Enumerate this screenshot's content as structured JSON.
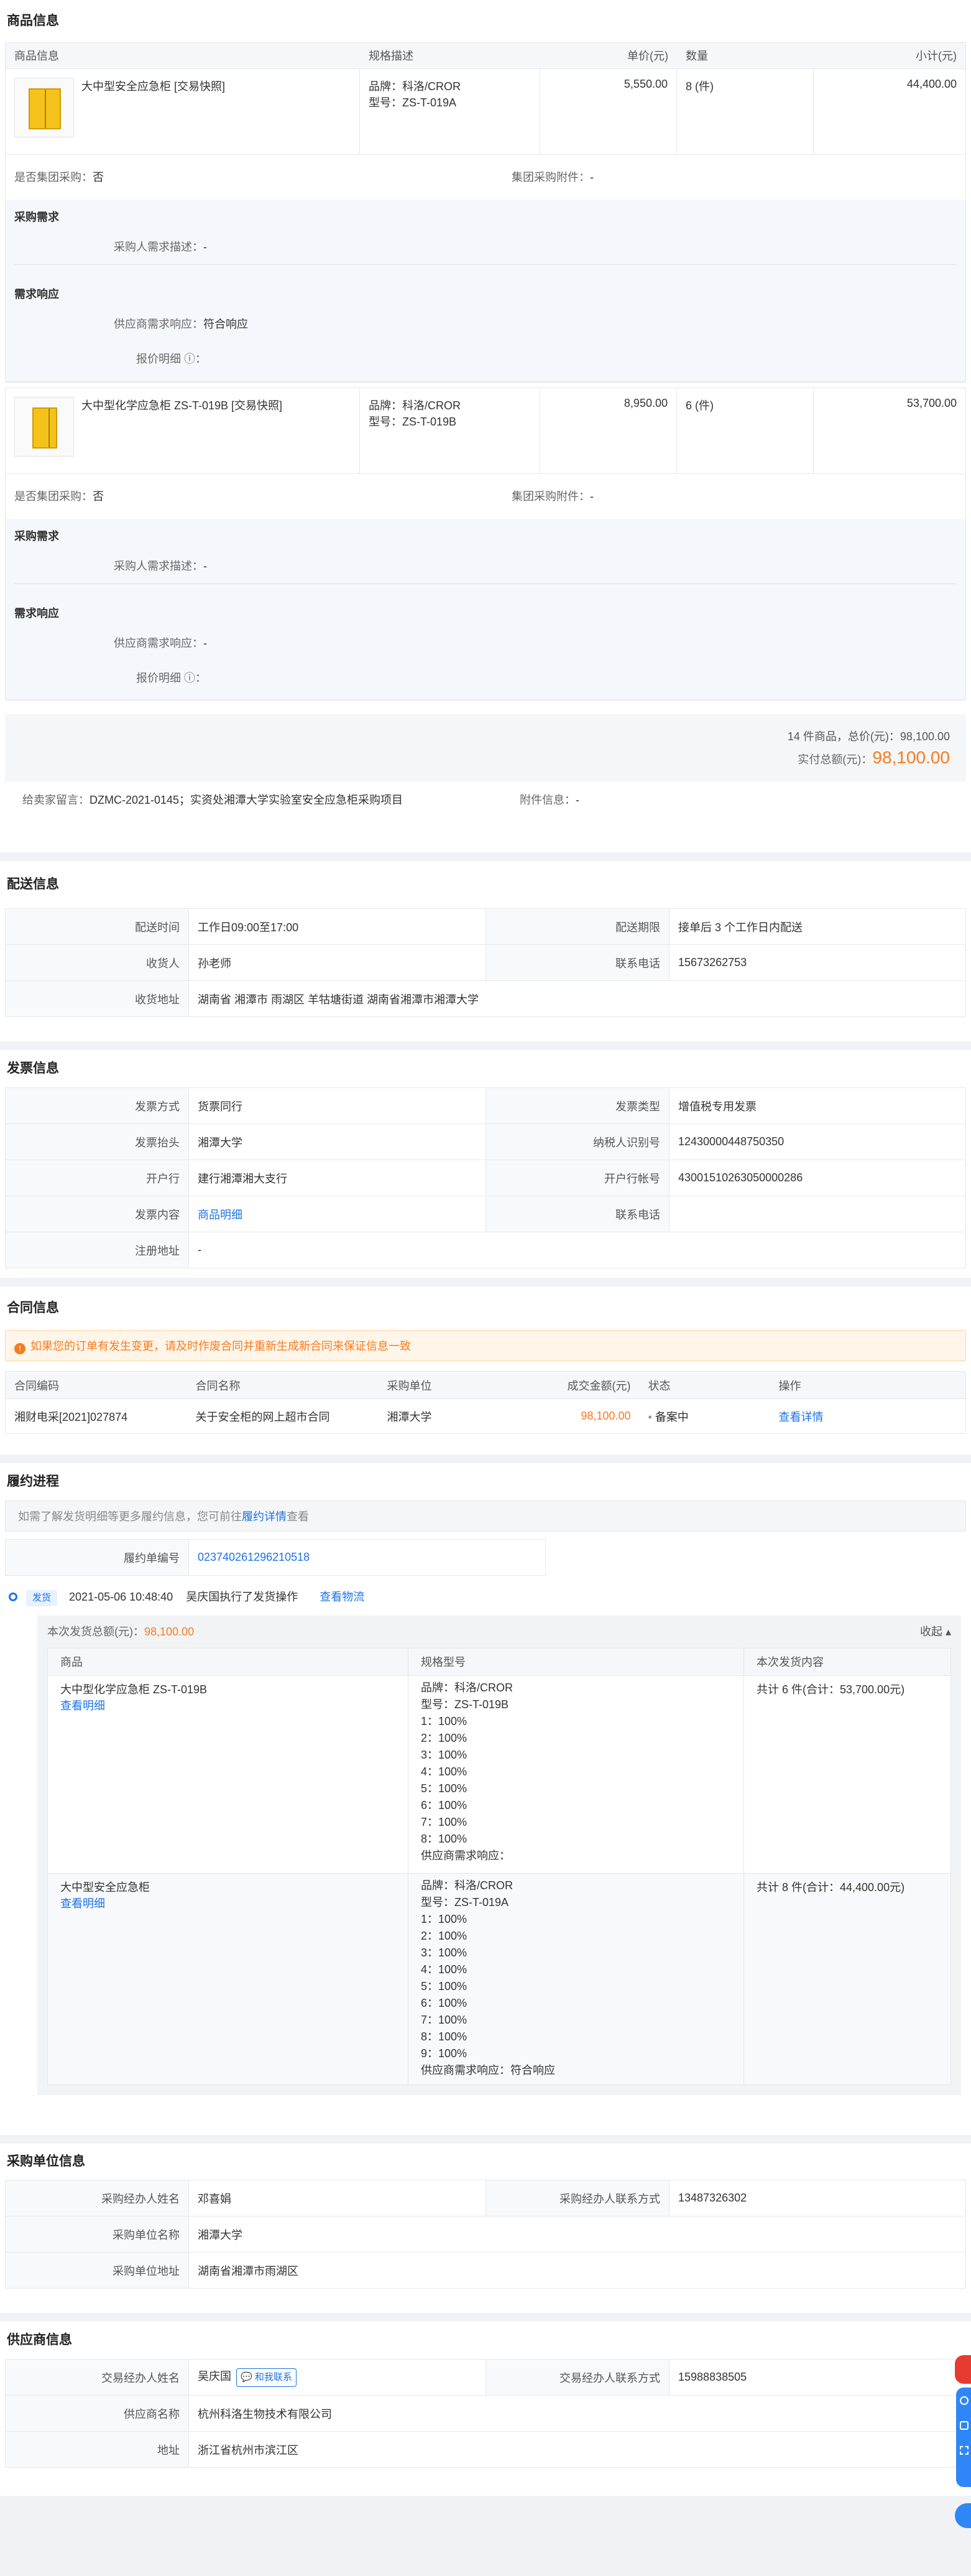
{
  "goods": {
    "title": "商品信息",
    "headers": [
      "商品信息",
      "规格描述",
      "单价(元)",
      "数量",
      "小计(元)"
    ],
    "items": [
      {
        "name": "大中型安全应急柜 [交易快照]",
        "brand": "品牌：科洛/CROR",
        "model": "型号：ZS-T-019A",
        "price": "5,550.00",
        "qty": "8 (件)",
        "subtotal": "44,400.00",
        "group_label": "是否集团采购：",
        "group_value": "否",
        "attach_label": "集团采购附件：",
        "attach_value": "-",
        "purchase_title": "采购需求",
        "purchase_desc_label": "采购人需求描述：",
        "purchase_desc_value": "-",
        "response_title": "需求响应",
        "response_label": "供应商需求响应：",
        "response_value": "符合响应",
        "quote_label": "报价明细 ⓘ："
      },
      {
        "name": "大中型化学应急柜 ZS-T-019B [交易快照]",
        "brand": "品牌：科洛/CROR",
        "model": "型号：ZS-T-019B",
        "price": "8,950.00",
        "qty": "6 (件)",
        "subtotal": "53,700.00",
        "group_label": "是否集团采购：",
        "group_value": "否",
        "attach_label": "集团采购附件：",
        "attach_value": "-",
        "purchase_title": "采购需求",
        "purchase_desc_label": "采购人需求描述：",
        "purchase_desc_value": "-",
        "response_title": "需求响应",
        "response_label": "供应商需求响应：",
        "response_value": "-",
        "quote_label": "报价明细 ⓘ："
      }
    ],
    "summary_line": "14 件商品，总价(元)：98,100.00",
    "paid_label": "实付总额(元)：",
    "paid_value": "98,100.00",
    "note_label": "给卖家留言：",
    "note_value": "DZMC-2021-0145；实资处湘潭大学实验室安全应急柜采购项目",
    "note_attach_label": "附件信息：",
    "note_attach_value": "-"
  },
  "delivery": {
    "title": "配送信息",
    "rows": [
      [
        "配送时间",
        "工作日09:00至17:00",
        "配送期限",
        "接单后 3 个工作日内配送"
      ],
      [
        "收货人",
        "孙老师",
        "联系电话",
        "15673262753"
      ],
      [
        "收货地址",
        "湖南省 湘潭市 雨湖区 羊牯塘街道 湖南省湘潭市湘潭大学",
        "",
        ""
      ]
    ]
  },
  "invoice": {
    "title": "发票信息",
    "rows": [
      [
        "发票方式",
        "货票同行",
        "发票类型",
        "增值税专用发票"
      ],
      [
        "发票抬头",
        "湘潭大学",
        "纳税人识别号",
        "12430000448750350"
      ],
      [
        "开户行",
        "建行湘潭湘大支行",
        "开户行帐号",
        "43001510263050000286"
      ],
      [
        "发票内容",
        "商品明细",
        "联系电话",
        ""
      ],
      [
        "注册地址",
        "-",
        "",
        ""
      ]
    ]
  },
  "contract": {
    "title": "合同信息",
    "alert": "如果您的订单有发生变更，请及时作废合同并重新生成新合同来保证信息一致",
    "headers": [
      "合同编码",
      "合同名称",
      "采购单位",
      "成交金额(元)",
      "状态",
      "操作"
    ],
    "row": [
      "湘财电采[2021]027874",
      "关于安全柜的网上超市合同",
      "湘潭大学",
      "98,100.00",
      "备案中",
      "查看详情"
    ]
  },
  "progress": {
    "title": "履约进程",
    "tip_pre": "如需了解发货明细等更多履约信息，您可前往",
    "tip_link": "履约详情",
    "tip_post": "查看",
    "order_label": "履约单编号",
    "order_value": "023740261296210518",
    "tag": "发货",
    "time": "2021-05-06 10:48:40",
    "actor": "吴庆国执行了发货操作",
    "logistics": "查看物流",
    "total_label": "本次发货总额(元)：",
    "total_value": "98,100.00",
    "collapse": "收起 ▴",
    "headers": [
      "商品",
      "规格型号",
      "本次发货内容"
    ],
    "items": [
      {
        "name": "大中型化学应急柜 ZS-T-019B",
        "detail": "查看明细",
        "specs": [
          "品牌：科洛/CROR",
          "型号：ZS-T-019B",
          "1：100%",
          "2：100%",
          "3：100%",
          "4：100%",
          "5：100%",
          "6：100%",
          "7：100%",
          "8：100%",
          "供应商需求响应："
        ],
        "content": "共计 6 件(合计：53,700.00元)"
      },
      {
        "name": "大中型安全应急柜",
        "detail": "查看明细",
        "specs": [
          "品牌：科洛/CROR",
          "型号：ZS-T-019A",
          "1：100%",
          "2：100%",
          "3：100%",
          "4：100%",
          "5：100%",
          "6：100%",
          "7：100%",
          "8：100%",
          "9：100%",
          "供应商需求响应：符合响应"
        ],
        "content": "共计 8 件(合计：44,400.00元)"
      }
    ]
  },
  "buyer": {
    "title": "采购单位信息",
    "rows": [
      [
        "采购经办人姓名",
        "邓喜娟",
        "采购经办人联系方式",
        "13487326302"
      ],
      [
        "采购单位名称",
        "湘潭大学",
        "",
        ""
      ],
      [
        "采购单位地址",
        "湖南省湘潭市雨湖区",
        "",
        ""
      ]
    ]
  },
  "supplier": {
    "title": "供应商信息",
    "rows": [
      [
        "交易经办人姓名",
        "吴庆国",
        "交易经办人联系方式",
        "15988838505"
      ],
      [
        "供应商名称",
        "杭州科洛生物技术有限公司",
        "",
        ""
      ],
      [
        "地址",
        "浙江省杭州市滨江区",
        "",
        ""
      ]
    ],
    "contact_btn": "和我联系"
  },
  "colors": {
    "accent": "#1a73e8",
    "orange": "#f57c22"
  }
}
